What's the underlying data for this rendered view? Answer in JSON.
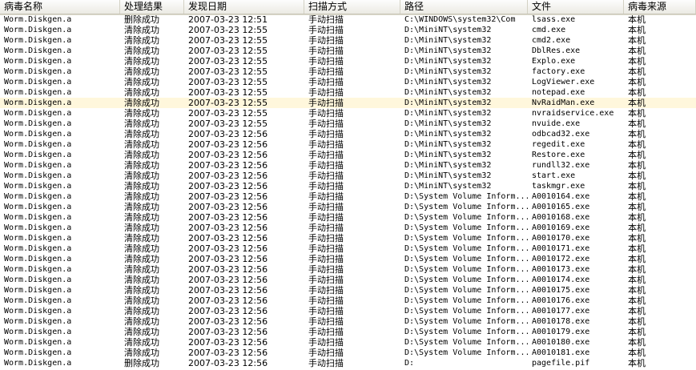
{
  "columns": [
    "病毒名称",
    "处理结果",
    "发现日期",
    "扫描方式",
    "路径",
    "文件",
    "病毒来源"
  ],
  "rows": [
    [
      "Worm.Diskgen.a",
      "删除成功",
      "2007-03-23 12:51",
      "手动扫描",
      "C:\\WINDOWS\\system32\\Com",
      "lsass.exe",
      "本机"
    ],
    [
      "Worm.Diskgen.a",
      "清除成功",
      "2007-03-23 12:55",
      "手动扫描",
      "D:\\MiniNT\\system32",
      "cmd.exe",
      "本机"
    ],
    [
      "Worm.Diskgen.a",
      "清除成功",
      "2007-03-23 12:55",
      "手动扫描",
      "D:\\MiniNT\\system32",
      "cmd2.exe",
      "本机"
    ],
    [
      "Worm.Diskgen.a",
      "清除成功",
      "2007-03-23 12:55",
      "手动扫描",
      "D:\\MiniNT\\system32",
      "DblRes.exe",
      "本机"
    ],
    [
      "Worm.Diskgen.a",
      "清除成功",
      "2007-03-23 12:55",
      "手动扫描",
      "D:\\MiniNT\\system32",
      "Explo.exe",
      "本机"
    ],
    [
      "Worm.Diskgen.a",
      "清除成功",
      "2007-03-23 12:55",
      "手动扫描",
      "D:\\MiniNT\\system32",
      "factory.exe",
      "本机"
    ],
    [
      "Worm.Diskgen.a",
      "清除成功",
      "2007-03-23 12:55",
      "手动扫描",
      "D:\\MiniNT\\system32",
      "LogViewer.exe",
      "本机"
    ],
    [
      "Worm.Diskgen.a",
      "清除成功",
      "2007-03-23 12:55",
      "手动扫描",
      "D:\\MiniNT\\system32",
      "notepad.exe",
      "本机"
    ],
    [
      "Worm.Diskgen.a",
      "清除成功",
      "2007-03-23 12:55",
      "手动扫描",
      "D:\\MiniNT\\system32",
      "NvRaidMan.exe",
      "本机"
    ],
    [
      "Worm.Diskgen.a",
      "清除成功",
      "2007-03-23 12:55",
      "手动扫描",
      "D:\\MiniNT\\system32",
      "nvraidservice.exe",
      "本机"
    ],
    [
      "Worm.Diskgen.a",
      "清除成功",
      "2007-03-23 12:55",
      "手动扫描",
      "D:\\MiniNT\\system32",
      "nvuide.exe",
      "本机"
    ],
    [
      "Worm.Diskgen.a",
      "清除成功",
      "2007-03-23 12:56",
      "手动扫描",
      "D:\\MiniNT\\system32",
      "odbcad32.exe",
      "本机"
    ],
    [
      "Worm.Diskgen.a",
      "清除成功",
      "2007-03-23 12:56",
      "手动扫描",
      "D:\\MiniNT\\system32",
      "regedit.exe",
      "本机"
    ],
    [
      "Worm.Diskgen.a",
      "清除成功",
      "2007-03-23 12:56",
      "手动扫描",
      "D:\\MiniNT\\system32",
      "Restore.exe",
      "本机"
    ],
    [
      "Worm.Diskgen.a",
      "清除成功",
      "2007-03-23 12:56",
      "手动扫描",
      "D:\\MiniNT\\system32",
      "rundll32.exe",
      "本机"
    ],
    [
      "Worm.Diskgen.a",
      "清除成功",
      "2007-03-23 12:56",
      "手动扫描",
      "D:\\MiniNT\\system32",
      "start.exe",
      "本机"
    ],
    [
      "Worm.Diskgen.a",
      "清除成功",
      "2007-03-23 12:56",
      "手动扫描",
      "D:\\MiniNT\\system32",
      "taskmgr.exe",
      "本机"
    ],
    [
      "Worm.Diskgen.a",
      "清除成功",
      "2007-03-23 12:56",
      "手动扫描",
      "D:\\System Volume Inform...",
      "A0010164.exe",
      "本机"
    ],
    [
      "Worm.Diskgen.a",
      "清除成功",
      "2007-03-23 12:56",
      "手动扫描",
      "D:\\System Volume Inform...",
      "A0010165.exe",
      "本机"
    ],
    [
      "Worm.Diskgen.a",
      "清除成功",
      "2007-03-23 12:56",
      "手动扫描",
      "D:\\System Volume Inform...",
      "A0010168.exe",
      "本机"
    ],
    [
      "Worm.Diskgen.a",
      "清除成功",
      "2007-03-23 12:56",
      "手动扫描",
      "D:\\System Volume Inform...",
      "A0010169.exe",
      "本机"
    ],
    [
      "Worm.Diskgen.a",
      "清除成功",
      "2007-03-23 12:56",
      "手动扫描",
      "D:\\System Volume Inform...",
      "A0010170.exe",
      "本机"
    ],
    [
      "Worm.Diskgen.a",
      "清除成功",
      "2007-03-23 12:56",
      "手动扫描",
      "D:\\System Volume Inform...",
      "A0010171.exe",
      "本机"
    ],
    [
      "Worm.Diskgen.a",
      "清除成功",
      "2007-03-23 12:56",
      "手动扫描",
      "D:\\System Volume Inform...",
      "A0010172.exe",
      "本机"
    ],
    [
      "Worm.Diskgen.a",
      "清除成功",
      "2007-03-23 12:56",
      "手动扫描",
      "D:\\System Volume Inform...",
      "A0010173.exe",
      "本机"
    ],
    [
      "Worm.Diskgen.a",
      "清除成功",
      "2007-03-23 12:56",
      "手动扫描",
      "D:\\System Volume Inform...",
      "A0010174.exe",
      "本机"
    ],
    [
      "Worm.Diskgen.a",
      "清除成功",
      "2007-03-23 12:56",
      "手动扫描",
      "D:\\System Volume Inform...",
      "A0010175.exe",
      "本机"
    ],
    [
      "Worm.Diskgen.a",
      "清除成功",
      "2007-03-23 12:56",
      "手动扫描",
      "D:\\System Volume Inform...",
      "A0010176.exe",
      "本机"
    ],
    [
      "Worm.Diskgen.a",
      "清除成功",
      "2007-03-23 12:56",
      "手动扫描",
      "D:\\System Volume Inform...",
      "A0010177.exe",
      "本机"
    ],
    [
      "Worm.Diskgen.a",
      "清除成功",
      "2007-03-23 12:56",
      "手动扫描",
      "D:\\System Volume Inform...",
      "A0010178.exe",
      "本机"
    ],
    [
      "Worm.Diskgen.a",
      "清除成功",
      "2007-03-23 12:56",
      "手动扫描",
      "D:\\System Volume Inform...",
      "A0010179.exe",
      "本机"
    ],
    [
      "Worm.Diskgen.a",
      "清除成功",
      "2007-03-23 12:56",
      "手动扫描",
      "D:\\System Volume Inform...",
      "A0010180.exe",
      "本机"
    ],
    [
      "Worm.Diskgen.a",
      "清除成功",
      "2007-03-23 12:56",
      "手动扫描",
      "D:\\System Volume Inform...",
      "A0010181.exe",
      "本机"
    ],
    [
      "Worm.Diskgen.a",
      "删除成功",
      "2007-03-23 12:56",
      "手动扫描",
      "D:",
      "pagefile.pif",
      "本机"
    ]
  ],
  "selected_row": 8,
  "colors": {
    "selected_row_bg": "#fff7dc",
    "header_bg": "#ebeae3"
  }
}
